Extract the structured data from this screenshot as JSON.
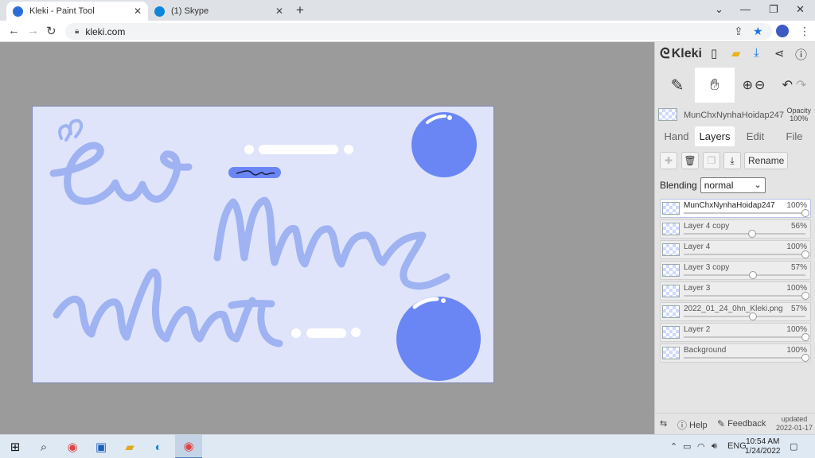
{
  "browser": {
    "tabs": [
      {
        "title": "Kleki - Paint Tool",
        "favicon_color": "#2b6fd6",
        "active": true
      },
      {
        "title": "(1) Skype",
        "favicon_color": "#0b86d9",
        "active": false
      }
    ],
    "url": "kleki.com"
  },
  "panel": {
    "logo": "Kleki",
    "current_layer": "MunChxNynhaHoidap247",
    "opacity_label": "Opacity",
    "opacity_value": "100%",
    "tabs": [
      "Hand",
      "Layers",
      "Edit",
      "File"
    ],
    "active_tab": "Layers",
    "rename_label": "Rename",
    "blending_label": "Blending",
    "blending_value": "normal",
    "layers": [
      {
        "name": "MunChxNynhaHoidap247",
        "opacity": "100%",
        "value": 1.0,
        "selected": true
      },
      {
        "name": "Layer 4 copy",
        "opacity": "56%",
        "value": 0.56,
        "selected": false
      },
      {
        "name": "Layer 4",
        "opacity": "100%",
        "value": 1.0,
        "selected": false
      },
      {
        "name": "Layer 3 copy",
        "opacity": "57%",
        "value": 0.57,
        "selected": false
      },
      {
        "name": "Layer 3",
        "opacity": "100%",
        "value": 1.0,
        "selected": false
      },
      {
        "name": "2022_01_24_0hn_Kleki.png",
        "opacity": "57%",
        "value": 0.57,
        "selected": false
      },
      {
        "name": "Layer 2",
        "opacity": "100%",
        "value": 1.0,
        "selected": false
      },
      {
        "name": "Background",
        "opacity": "100%",
        "value": 1.0,
        "selected": false
      }
    ],
    "footer": {
      "help": "Help",
      "feedback": "Feedback",
      "updated_label": "updated",
      "updated_date": "2022-01-17"
    }
  },
  "canvas": {
    "background": "#dfe4fb",
    "accent": "#6a86f5",
    "stroke": "#9fb2f2"
  },
  "taskbar": {
    "language": "ENG",
    "time": "10:54 AM",
    "date": "1/24/2022"
  }
}
